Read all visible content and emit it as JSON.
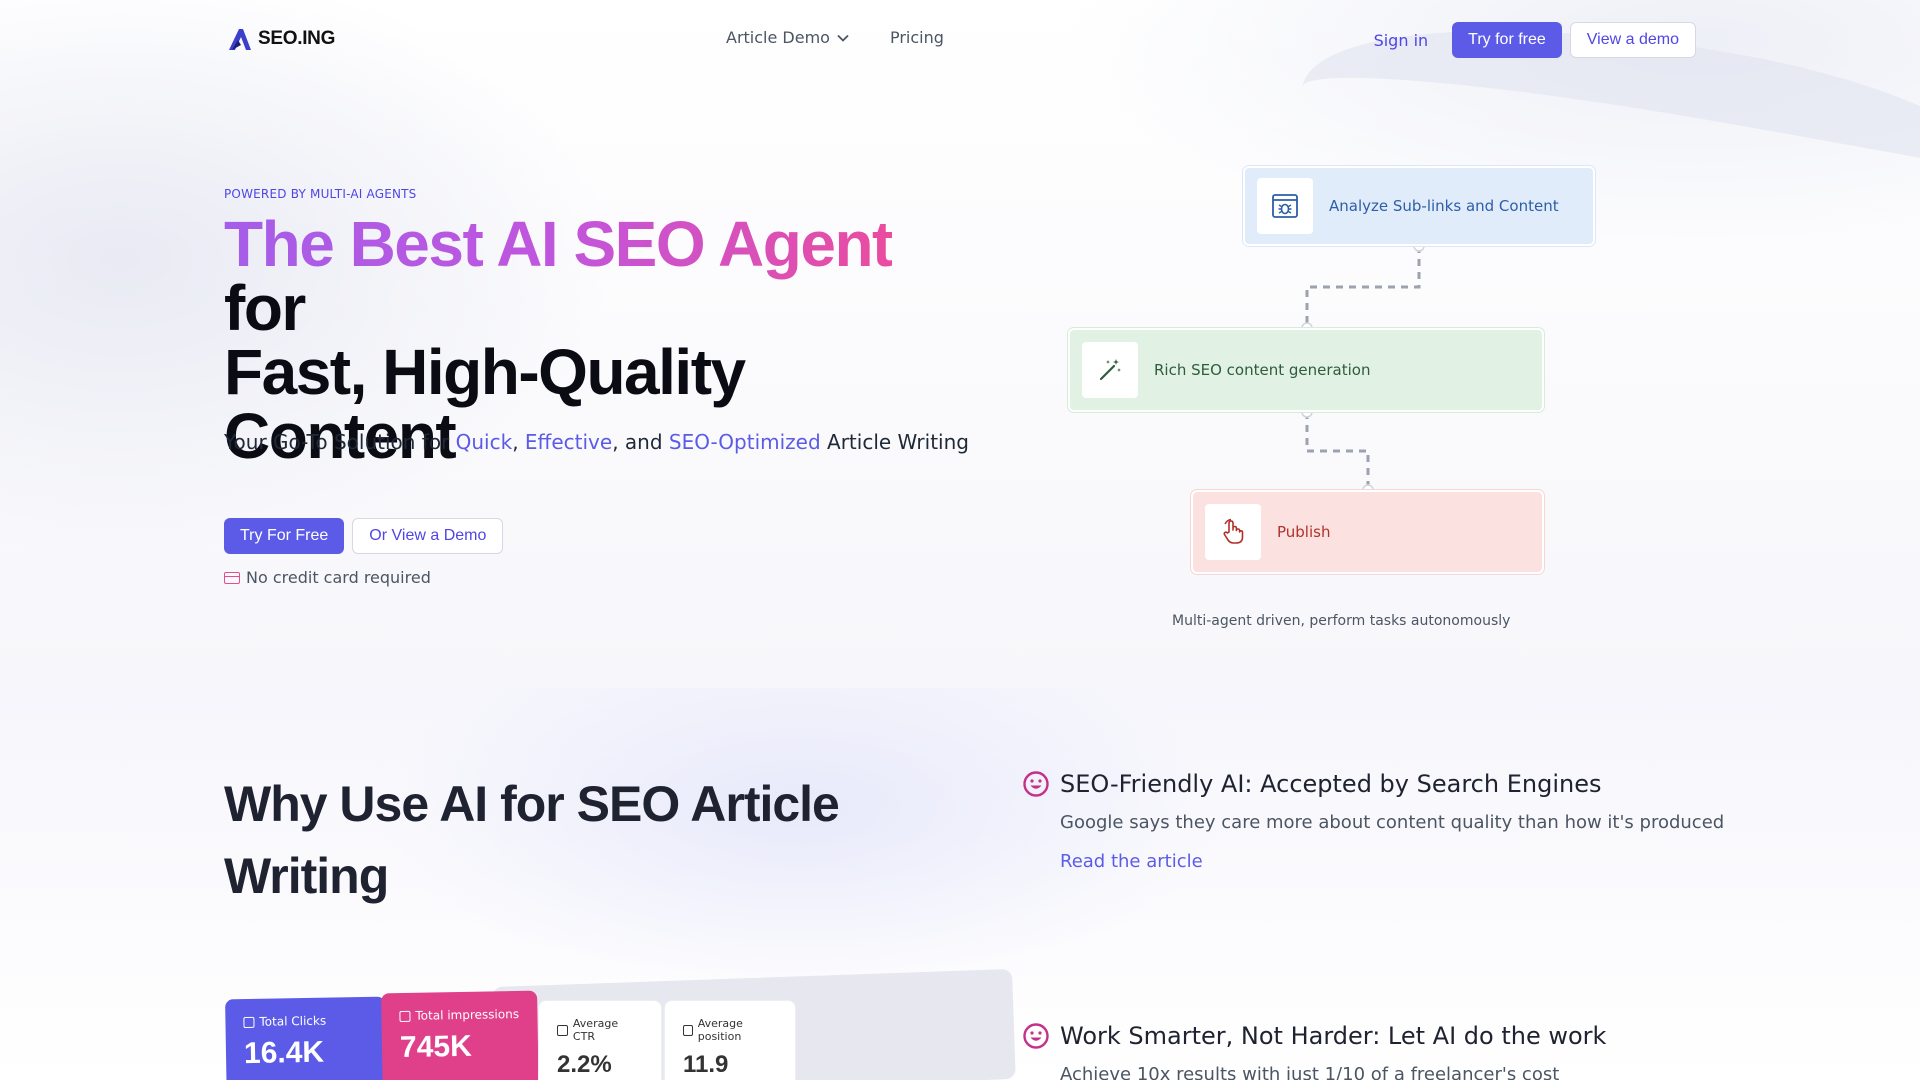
{
  "nav": {
    "logo_text": "SEO.ING",
    "links": [
      "Article Demo",
      "Pricing"
    ],
    "sign_in": "Sign in",
    "try_free": "Try for free",
    "view_demo": "View a demo"
  },
  "hero": {
    "eyebrow": "POWERED BY MULTI-AI AGENTS",
    "headline_gradient": "The Best AI SEO Agent",
    "headline_rest_1": " for",
    "headline_rest_2": "Fast, High-Quality",
    "headline_rest_3": "Content",
    "sub_prefix": "Your Go-To Solution for ",
    "sub_quick": "Quick",
    "sub_sep1": ", ",
    "sub_effective": "Effective",
    "sub_sep2": ", and ",
    "sub_seo": "SEO-Optimized",
    "sub_suffix": " Article Writing",
    "cta_primary": "Try For Free",
    "cta_secondary": "Or View a Demo",
    "no_card": "No credit card required"
  },
  "flow": {
    "steps": [
      {
        "label": "Analyze Sub-links and Content",
        "icon": "browser-bug-icon"
      },
      {
        "label": "Rich SEO content generation",
        "icon": "magic-wand-icon"
      },
      {
        "label": "Publish",
        "icon": "pointer-hand-icon"
      }
    ],
    "caption": "Multi-agent driven, perform tasks autonomously"
  },
  "why": {
    "title": "Why Use AI for SEO Article Writing",
    "features": [
      {
        "title": "SEO-Friendly AI: Accepted by Search Engines",
        "desc": "Google says they care more about content quality than how it's produced",
        "link": "Read the article"
      },
      {
        "title": "Work Smarter, Not Harder: Let AI do the work",
        "desc": "Achieve 10x results with just 1/10 of a freelancer's cost"
      }
    ]
  },
  "metrics": [
    {
      "label": "Total Clicks",
      "value": "16.4K"
    },
    {
      "label": "Total impressions",
      "value": "745K"
    },
    {
      "label": "Average CTR",
      "value": "2.2%"
    },
    {
      "label": "Average position",
      "value": "11.9"
    }
  ],
  "colors": {
    "accent": "#5b5be8",
    "pink": "#e0408a",
    "step1_bg": "#e1ecfb",
    "step2_bg": "#e1f2e5",
    "step3_bg": "#fbe2e0"
  }
}
